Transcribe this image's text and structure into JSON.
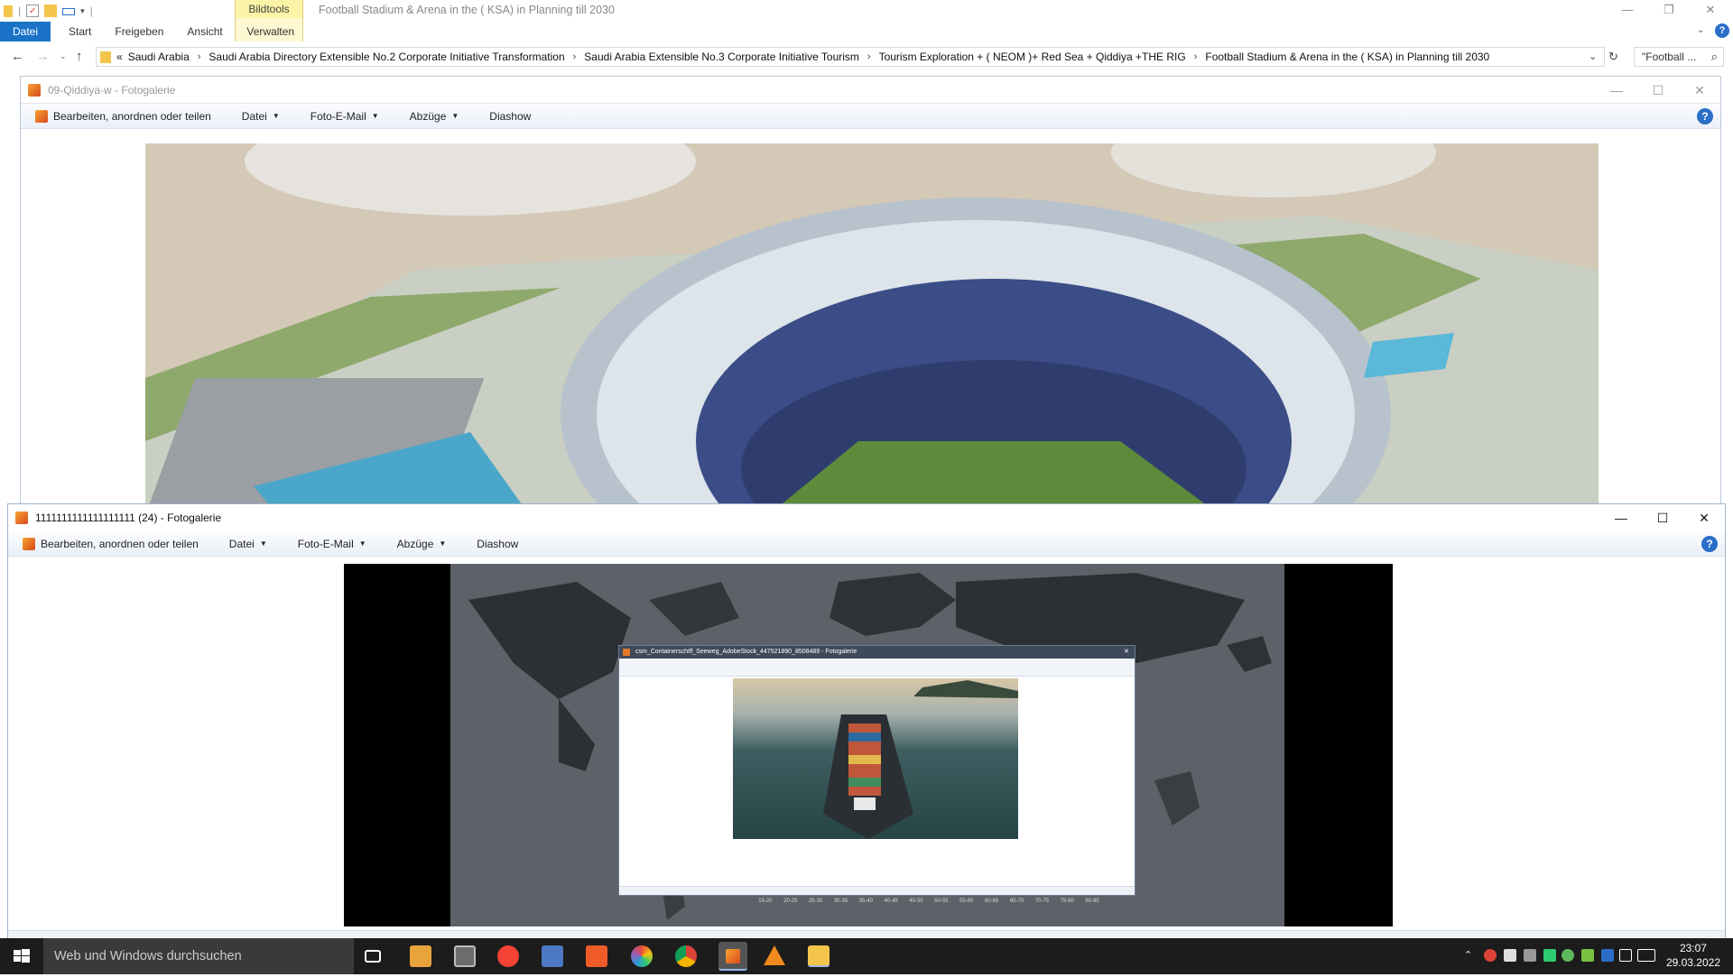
{
  "explorer": {
    "ribbon_context_label": "Bildtools",
    "window_title": "Football Stadium & Arena in the ( KSA) in Planning till 2030",
    "tabs": [
      "Datei",
      "Start",
      "Freigeben",
      "Ansicht",
      "Verwalten"
    ],
    "address": {
      "prefix": "«",
      "crumbs": [
        "Saudi Arabia",
        "Saudi Arabia Directory Extensible No.2  Corporate Initiative Transformation",
        "Saudi Arabia Extensible No.3 Corporate Initiative Tourism",
        "Tourism Exploration + ( NEOM )+ Red Sea + Qiddiya +THE RIG",
        "Football Stadium & Arena in the ( KSA) in Planning till 2030"
      ]
    },
    "search_placeholder": "\"Football ..."
  },
  "photo_window_1": {
    "title": "09-Qiddiya-w - Fotogalerie",
    "toolbar": [
      "Bearbeiten, anordnen oder teilen",
      "Datei",
      "Foto-E-Mail",
      "Abzüge",
      "Diashow"
    ]
  },
  "photo_window_2": {
    "title": "1111111111111111111 (24) - Fotogalerie",
    "toolbar": [
      "Bearbeiten, anordnen oder teilen",
      "Datei",
      "Foto-E-Mail",
      "Abzüge",
      "Diashow"
    ],
    "legend_labels": [
      "15-20",
      "20-25",
      "25-30",
      "30-35",
      "35-40",
      "40-45",
      "45-50",
      "50-55",
      "55-60",
      "60-65",
      "65-70",
      "70-75",
      "75-80",
      "80-85"
    ]
  },
  "nested_window": {
    "title": "csm_Containerschiff_Seeweg_AdobeStock_447521890_8508489 - Fotogalerie"
  },
  "taskbar": {
    "search_placeholder": "Web und Windows durchsuchen",
    "time": "23:07",
    "date": "29.03.2022"
  },
  "colors": {
    "accent": "#1a73c7",
    "context_tab": "#fbf3a6",
    "taskbar": "#1c1c1c"
  }
}
